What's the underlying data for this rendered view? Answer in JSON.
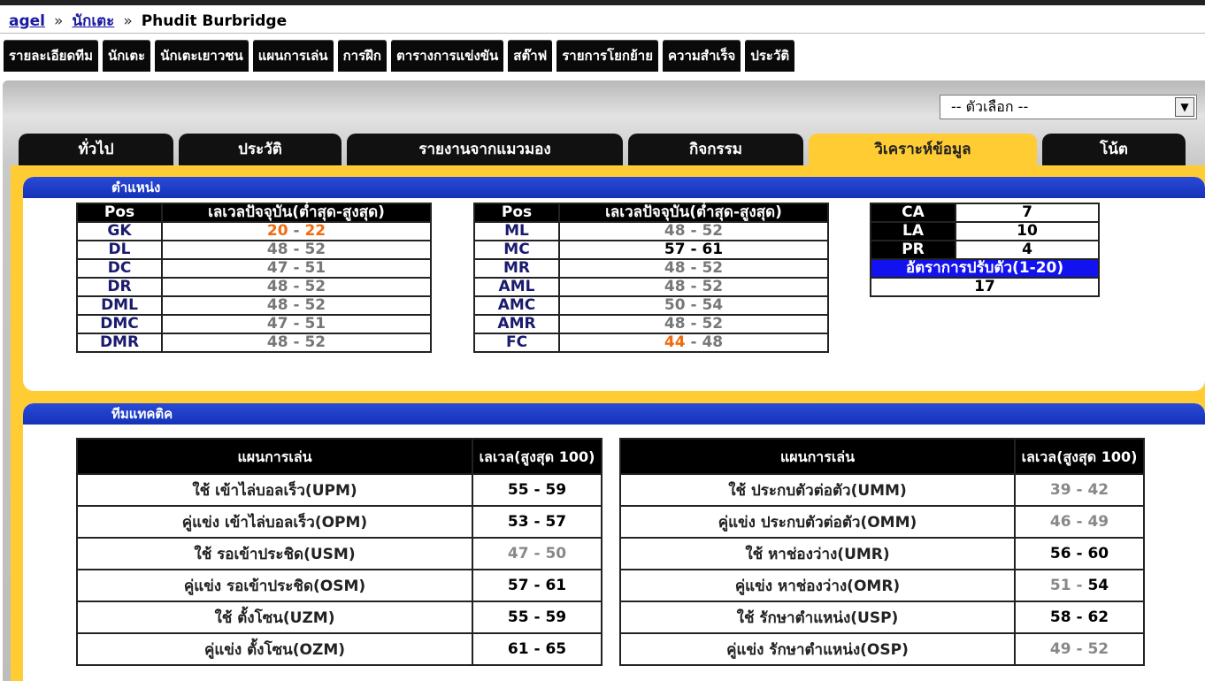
{
  "breadcrumb": {
    "root": "agel",
    "players": "นักเตะ",
    "current": "Phudit Burbridge",
    "sep": "»"
  },
  "menu": [
    "รายละเอียดทีม",
    "นักเตะ",
    "นักเตะเยาวชน",
    "แผนการเล่น",
    "การฝึก",
    "ตารางการแข่งขัน",
    "สต๊าฟ",
    "รายการโยกย้าย",
    "ความสำเร็จ",
    "ประวัติ"
  ],
  "select": {
    "value": "-- ตัวเลือก --",
    "arrow": "▼"
  },
  "tabs": [
    "ทั่วไป",
    "ประวัติ",
    "รายงานจากแมวมอง",
    "กิจกรรม",
    "วิเคราะห์ข้อมูล",
    "โน้ต"
  ],
  "positions": {
    "title": "ตำแหน่ง",
    "col_pos": "Pos",
    "col_level": "เลเวลปัจจุบัน(ต่ำสุด-สูงสุด)",
    "left": [
      {
        "pos": "GK",
        "min": "20",
        "max": "22"
      },
      {
        "pos": "DL",
        "min": "48",
        "max": "52"
      },
      {
        "pos": "DC",
        "min": "47",
        "max": "51"
      },
      {
        "pos": "DR",
        "min": "48",
        "max": "52"
      },
      {
        "pos": "DML",
        "min": "48",
        "max": "52"
      },
      {
        "pos": "DMC",
        "min": "47",
        "max": "51"
      },
      {
        "pos": "DMR",
        "min": "48",
        "max": "52"
      }
    ],
    "right": [
      {
        "pos": "ML",
        "min": "48",
        "max": "52"
      },
      {
        "pos": "MC",
        "min": "57",
        "max": "61"
      },
      {
        "pos": "MR",
        "min": "48",
        "max": "52"
      },
      {
        "pos": "AML",
        "min": "48",
        "max": "52"
      },
      {
        "pos": "AMC",
        "min": "50",
        "max": "54"
      },
      {
        "pos": "AMR",
        "min": "48",
        "max": "52"
      },
      {
        "pos": "FC",
        "min": "44",
        "max": "48"
      }
    ],
    "dash": " - "
  },
  "attrs": {
    "ca_label": "CA",
    "ca": "7",
    "la_label": "LA",
    "la": "10",
    "pr_label": "PR",
    "pr": "4",
    "adapt_label": "อัตราการปรับตัว(1-20)",
    "adapt": "17"
  },
  "tactics": {
    "title": "ทีมแทคติค",
    "col_plan": "แผนการเล่น",
    "col_level": "เลเวล(สูงสุด 100)",
    "left": [
      {
        "name": "ใช้ เข้าไล่บอลเร็ว(UPM)",
        "min": "55",
        "max": "59"
      },
      {
        "name": "คู่แข่ง เข้าไล่บอลเร็ว(OPM)",
        "min": "53",
        "max": "57"
      },
      {
        "name": "ใช้ รอเข้าประชิด(USM)",
        "min": "47",
        "max": "50"
      },
      {
        "name": "คู่แข่ง รอเข้าประชิด(OSM)",
        "min": "57",
        "max": "61"
      },
      {
        "name": "ใช้ ตั้งโซน(UZM)",
        "min": "55",
        "max": "59"
      },
      {
        "name": "คู่แข่ง ตั้งโซน(OZM)",
        "min": "61",
        "max": "65"
      }
    ],
    "right": [
      {
        "name": "ใช้ ประกบตัวต่อตัว(UMM)",
        "min": "39",
        "max": "42"
      },
      {
        "name": "คู่แข่ง ประกบตัวต่อตัว(OMM)",
        "min": "46",
        "max": "49"
      },
      {
        "name": "ใช้ หาช่องว่าง(UMR)",
        "min": "56",
        "max": "60"
      },
      {
        "name": "คู่แข่ง หาช่องว่าง(OMR)",
        "min": "51",
        "max": "54"
      },
      {
        "name": "ใช้ รักษาตำแหน่ง(USP)",
        "min": "58",
        "max": "62"
      },
      {
        "name": "คู่แข่ง รักษาตำแหน่ง(OSP)",
        "min": "49",
        "max": "52"
      }
    ]
  }
}
